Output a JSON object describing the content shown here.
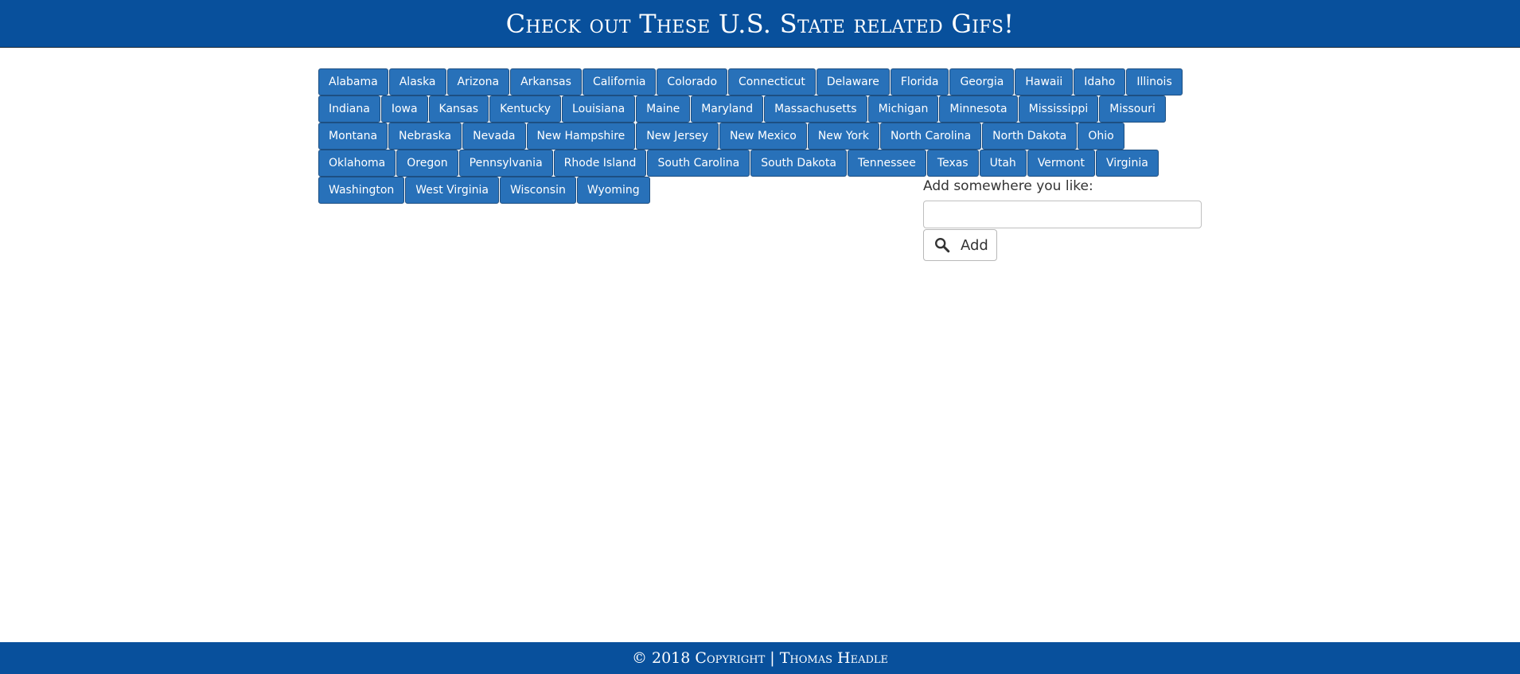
{
  "header": {
    "title": "Check out These U.S. State related Gifs!"
  },
  "states": [
    "Alabama",
    "Alaska",
    "Arizona",
    "Arkansas",
    "California",
    "Colorado",
    "Connecticut",
    "Delaware",
    "Florida",
    "Georgia",
    "Hawaii",
    "Idaho",
    "Illinois",
    "Indiana",
    "Iowa",
    "Kansas",
    "Kentucky",
    "Louisiana",
    "Maine",
    "Maryland",
    "Massachusetts",
    "Michigan",
    "Minnesota",
    "Mississippi",
    "Missouri",
    "Montana",
    "Nebraska",
    "Nevada",
    "New Hampshire",
    "New Jersey",
    "New Mexico",
    "New York",
    "North Carolina",
    "North Dakota",
    "Ohio",
    "Oklahoma",
    "Oregon",
    "Pennsylvania",
    "Rhode Island",
    "South Carolina",
    "South Dakota",
    "Tennessee",
    "Texas",
    "Utah",
    "Vermont",
    "Virginia",
    "Washington",
    "West Virginia",
    "Wisconsin",
    "Wyoming"
  ],
  "add_form": {
    "label": "Add somewhere you like:",
    "input_value": "",
    "button_label": "Add",
    "button_icon": "search-icon"
  },
  "footer": {
    "text": "© 2018 Copyright | Thomas Headle"
  },
  "colors": {
    "header_bg": "#08509c",
    "button_bg": "#2871b9",
    "footer_bg": "#08509c"
  }
}
